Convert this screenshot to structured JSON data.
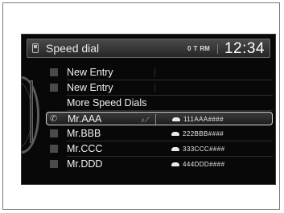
{
  "header": {
    "title": "Speed dial",
    "status": [
      "0",
      "T",
      "RM"
    ],
    "clock": "12:34"
  },
  "list": {
    "items": [
      {
        "label": "New Entry"
      },
      {
        "label": "New Entry"
      },
      {
        "label": "More Speed Dials"
      },
      {
        "label": "Mr.AAA",
        "number": "111AAA####",
        "selected": true
      },
      {
        "label": "Mr.BBB",
        "number": "222BBB####"
      },
      {
        "label": "Mr.CCC",
        "number": "333CCC####"
      },
      {
        "label": "Mr.DDD",
        "number": "444DDD####"
      }
    ]
  },
  "colors": {
    "screen_bg": "#080808",
    "text": "#f1f1f1",
    "selection_border": "#d8d8d8"
  }
}
